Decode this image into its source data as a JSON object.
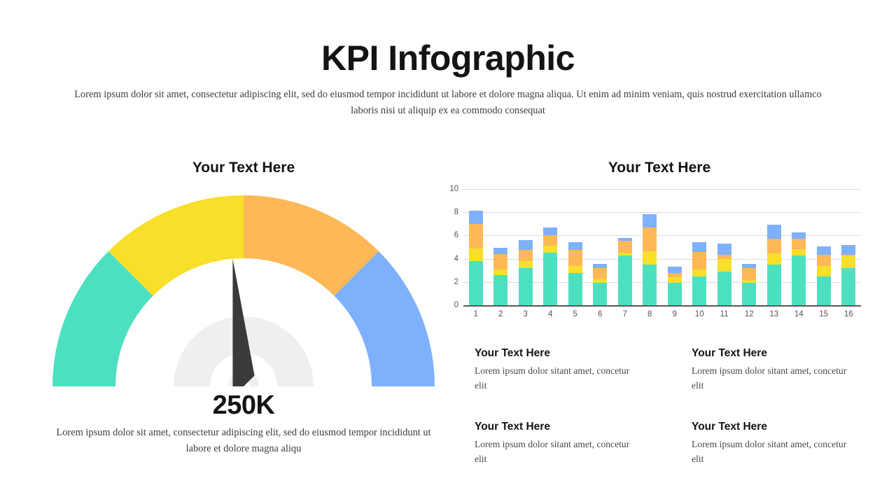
{
  "header": {
    "title": "KPI Infographic",
    "subtitle": "Lorem ipsum dolor sit amet, consectetur adipiscing elit, sed do eiusmod tempor incididunt ut labore et dolore magna aliqua. Ut enim ad minim veniam, quis nostrud exercitation ullamco laboris nisi ut aliquip ex ea commodo consequat"
  },
  "gauge": {
    "title": "Your Text Here",
    "value_label": "250K",
    "caption": "Lorem ipsum dolor sit amet, consectetur adipiscing elit, sed do eiusmod tempor incididunt ut labore et dolore magna aliqu",
    "needle_angle_deg": 135,
    "needle_color": "#3a3a3a",
    "hub_color": "#efefef",
    "segments": [
      {
        "name": "teal-segment",
        "color": "#4DE0C0",
        "start_deg": 180,
        "end_deg": 135
      },
      {
        "name": "yellow-segment",
        "color": "#F7DF2A",
        "start_deg": 135,
        "end_deg": 90
      },
      {
        "name": "orange-segment",
        "color": "#FFB857",
        "start_deg": 90,
        "end_deg": 45
      },
      {
        "name": "blue-segment",
        "color": "#7FB0FC",
        "start_deg": 45,
        "end_deg": 0
      }
    ]
  },
  "chart_data": {
    "type": "bar",
    "title": "Your Text Here",
    "xlabel": "",
    "ylabel": "",
    "ylim": [
      0,
      10
    ],
    "yticks": [
      0,
      2,
      4,
      6,
      8,
      10
    ],
    "grid": true,
    "legend": "none",
    "stacked": true,
    "categories": [
      "1",
      "2",
      "3",
      "4",
      "5",
      "6",
      "7",
      "8",
      "9",
      "10",
      "11",
      "12",
      "13",
      "14",
      "15",
      "16"
    ],
    "series": [
      {
        "name": "Teal",
        "color": "#4DE0C0",
        "values": [
          3.8,
          2.6,
          3.2,
          4.5,
          2.8,
          1.9,
          4.3,
          3.5,
          1.9,
          2.5,
          2.9,
          1.9,
          3.5,
          4.3,
          2.5,
          3.2
        ]
      },
      {
        "name": "Yellow",
        "color": "#F7DF2A",
        "values": [
          1.1,
          0.5,
          0.6,
          0.6,
          0.6,
          0.4,
          0.2,
          1.15,
          0.5,
          0.6,
          1.1,
          0.3,
          0.95,
          0.55,
          0.9,
          1.05
        ]
      },
      {
        "name": "Orange",
        "color": "#FFB857",
        "values": [
          2.1,
          1.3,
          0.95,
          0.95,
          1.35,
          0.9,
          1.05,
          2.05,
          0.4,
          1.5,
          0.35,
          1.0,
          1.25,
          0.85,
          0.95,
          0.1
        ]
      },
      {
        "name": "Blue",
        "color": "#7FB0FC",
        "values": [
          1.15,
          0.55,
          0.85,
          0.65,
          0.7,
          0.35,
          0.25,
          1.15,
          0.5,
          0.8,
          0.95,
          0.35,
          1.2,
          0.55,
          0.7,
          0.85
        ]
      }
    ],
    "totals": [
      8.15,
      4.95,
      5.6,
      6.7,
      5.45,
      3.55,
      5.8,
      7.85,
      3.3,
      5.4,
      5.3,
      3.55,
      6.9,
      6.25,
      5.05,
      5.2
    ]
  },
  "text_blocks": [
    {
      "title": "Your Text Here",
      "body": "Lorem ipsum dolor sitant amet, concetur elit"
    },
    {
      "title": "Your Text Here",
      "body": "Lorem ipsum dolor sitant amet, concetur elit"
    },
    {
      "title": "Your Text Here",
      "body": "Lorem ipsum dolor sitant amet, concetur elit"
    },
    {
      "title": "Your Text Here",
      "body": "Lorem ipsum dolor sitant amet, concetur elit"
    }
  ]
}
